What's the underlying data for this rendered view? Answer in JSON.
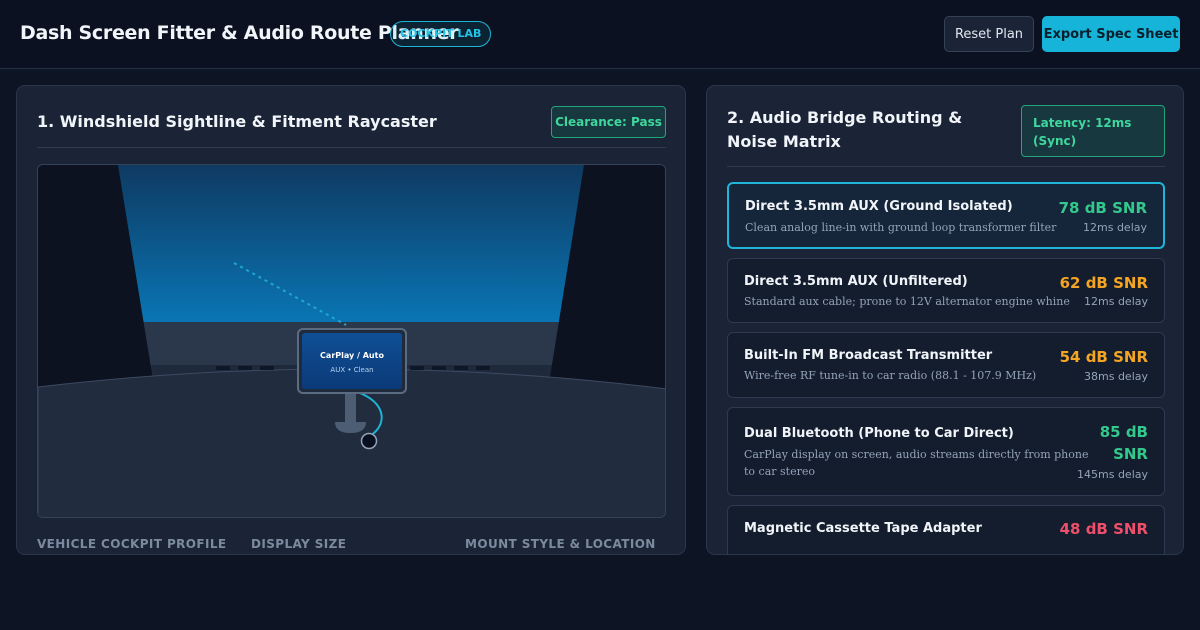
{
  "header": {
    "title": "Dash Screen Fitter & Audio Route Planner",
    "badge": "COCKPIT LAB",
    "reset_label": "Reset Plan",
    "export_label": "Export Spec Sheet"
  },
  "sightline_panel": {
    "title": "1. Windshield Sightline & Fitment Raycaster",
    "clearance_badge": "Clearance: Pass",
    "screen_title": "CarPlay / Auto",
    "screen_subtitle": "AUX • Clean",
    "field_labels": [
      "VEHICLE COCKPIT PROFILE",
      "DISPLAY SIZE",
      "MOUNT STYLE & LOCATION"
    ]
  },
  "audio_panel": {
    "title": "2. Audio Bridge Routing & Noise Matrix",
    "latency_badge": "Latency: 12ms (Sync)",
    "routes": [
      {
        "name": "Direct 3.5mm AUX (Ground Isolated)",
        "desc": "Clean analog line-in with ground loop transformer filter",
        "snr": "78 dB SNR",
        "delay": "12ms delay",
        "color": "#34c98c",
        "selected": true
      },
      {
        "name": "Direct 3.5mm AUX (Unfiltered)",
        "desc": "Standard aux cable; prone to 12V alternator engine whine",
        "snr": "62 dB SNR",
        "delay": "12ms delay",
        "color": "#f5a524",
        "selected": false
      },
      {
        "name": "Built-In FM Broadcast Transmitter",
        "desc": "Wire-free RF tune-in to car radio (88.1 - 107.9 MHz)",
        "snr": "54 dB SNR",
        "delay": "38ms delay",
        "color": "#f5a524",
        "selected": false
      },
      {
        "name": "Dual Bluetooth (Phone to Car Direct)",
        "desc": "CarPlay display on screen, audio streams directly from phone to car stereo",
        "snr": "85 dB SNR",
        "delay": "145ms delay",
        "color": "#34c98c",
        "selected": false
      },
      {
        "name": "Magnetic Cassette Tape Adapter",
        "desc": "",
        "snr": "48 dB SNR",
        "delay": "",
        "color": "#ef4f6a",
        "selected": false
      }
    ]
  },
  "colors": {
    "accent": "#16b4d8",
    "pass": "#3fd79d",
    "warn": "#f5a524",
    "bad": "#ef4f6a"
  }
}
